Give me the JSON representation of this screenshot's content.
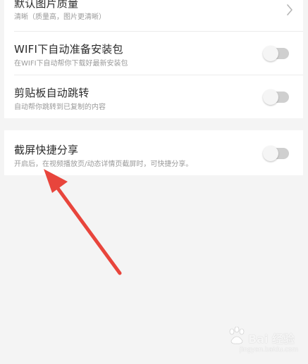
{
  "settings": {
    "image_quality": {
      "title": "默认图片质量",
      "subtitle": "清晰（质量高，图片更清晰）",
      "icon": "chevron-right-icon"
    },
    "wifi_package": {
      "title": "WIFI下自动准备安装包",
      "subtitle": "在WIFI下自动帮你下载好最新安装包",
      "toggle_on": false
    },
    "clipboard_jump": {
      "title": "剪贴板自动跳转",
      "subtitle": "自动帮你跳转到已复制的内容",
      "toggle_on": false
    },
    "screenshot_share": {
      "title": "截屏快捷分享",
      "subtitle": "开启后，在视频播放页/动态详情页截屏时，可快捷分享。",
      "toggle_on": false
    }
  },
  "colors": {
    "background": "#f4f4f4",
    "card": "#ffffff",
    "toggle_track_off": "#cfcfcf",
    "toggle_knob": "#f5f5f5",
    "annotation_arrow": "#e8453c"
  },
  "watermark": {
    "brand": "Bai 经验",
    "url": "jingyan.baidu.com"
  }
}
